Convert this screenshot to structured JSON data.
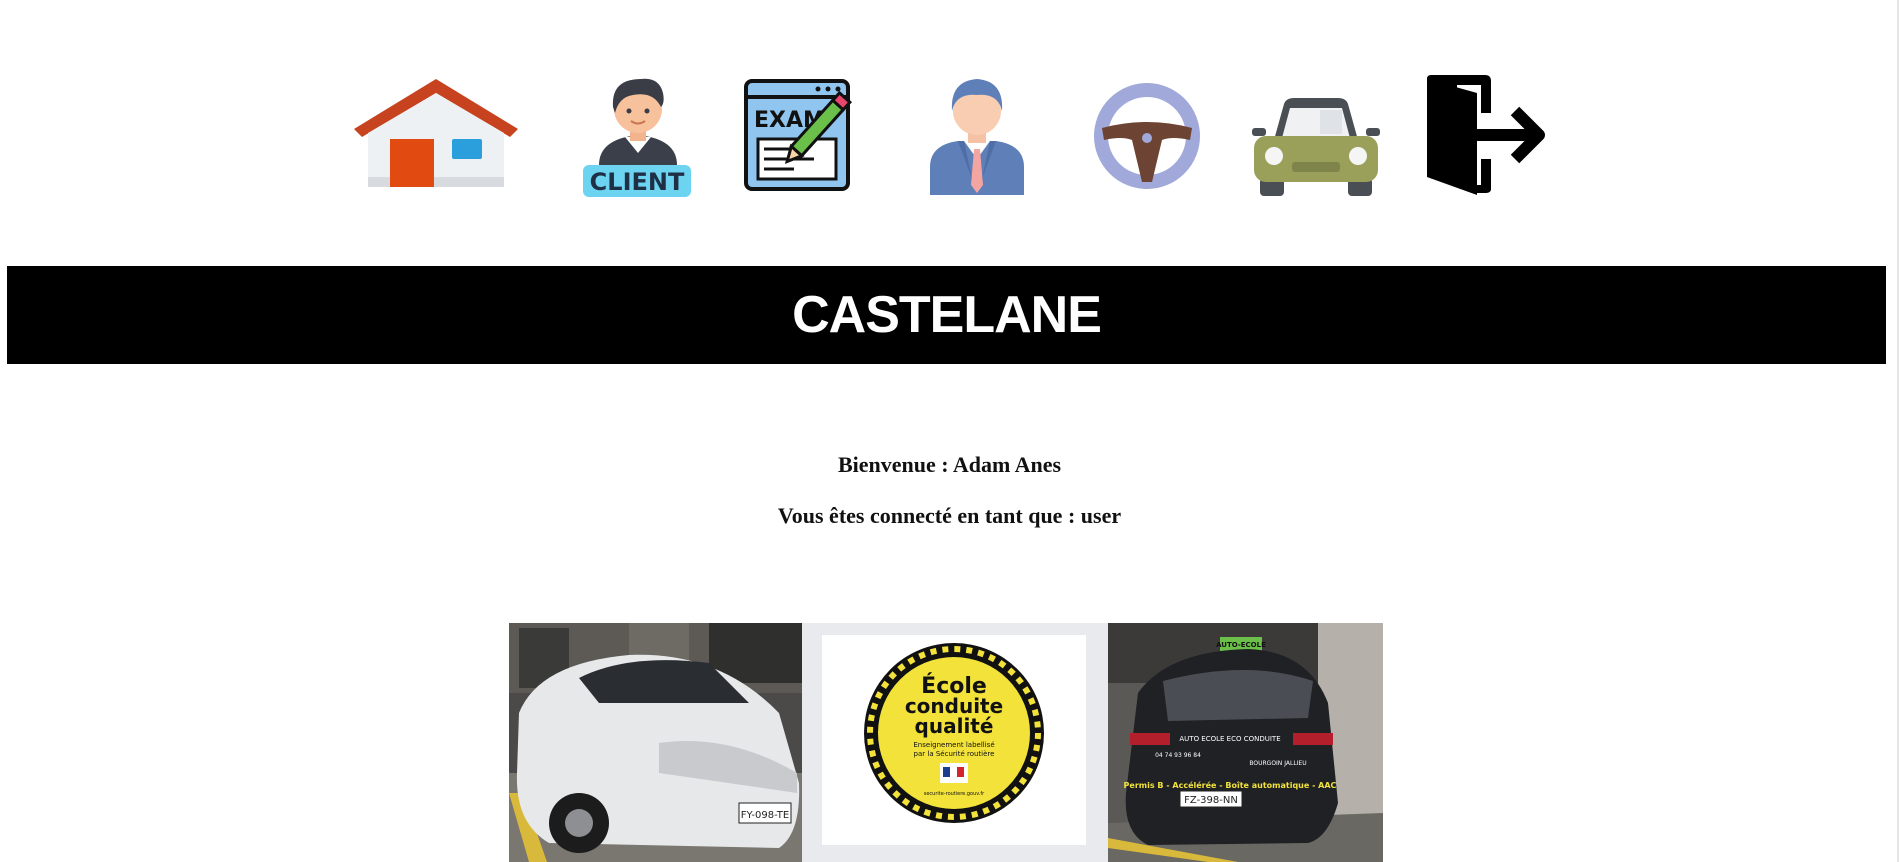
{
  "nav": {
    "items": [
      {
        "id": "home",
        "icon": "home-icon",
        "label": ""
      },
      {
        "id": "client",
        "icon": "client-icon",
        "badge_text": "CLIENT"
      },
      {
        "id": "exam",
        "icon": "exam-icon",
        "badge_text": "EXAM"
      },
      {
        "id": "moniteur",
        "icon": "person-suit-icon"
      },
      {
        "id": "lecon",
        "icon": "steering-wheel-icon"
      },
      {
        "id": "vehicule",
        "icon": "car-icon"
      },
      {
        "id": "logout",
        "icon": "logout-icon"
      }
    ]
  },
  "header": {
    "title": "CASTELANE"
  },
  "welcome": {
    "greeting": "Bienvenue : Adam Anes",
    "role_line": "Vous êtes connecté en tant que : user"
  },
  "gallery": {
    "photo1": {
      "plate": "FY-098-TE"
    },
    "badge": {
      "line1": "École",
      "line2": "conduite",
      "line3": "qualité",
      "sub1": "Enseignement labellisé",
      "sub2": "par la Sécurité routière",
      "url": "securite-routiere.gouv.fr"
    },
    "photo2": {
      "roof_sign": "AUTO-ECOLE",
      "rear_text": "AUTO ECOLE ECO CONDUITE",
      "phone": "04 74 93 96 84",
      "city": "BOURGOIN JALLIEU",
      "slogan": "Permis B - Accélérée - Boîte automatique - AAC",
      "plate": "FZ-398-NN"
    }
  },
  "colors": {
    "header_bg": "#000000",
    "header_text": "#ffffff",
    "badge_yellow": "#f2e23a"
  }
}
